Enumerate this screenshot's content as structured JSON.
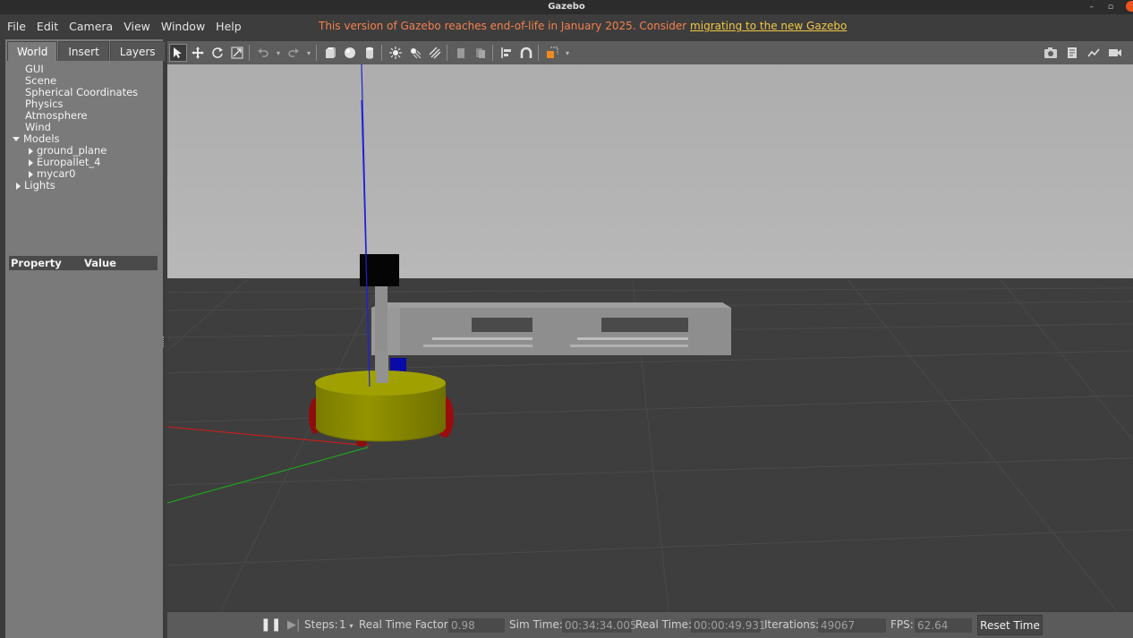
{
  "window": {
    "title": "Gazebo",
    "minimize": "–",
    "maximize": "▫"
  },
  "menu": {
    "items": [
      "File",
      "Edit",
      "Camera",
      "View",
      "Window",
      "Help"
    ],
    "eol_text": "This version of Gazebo reaches end-of-life in January 2025. Consider",
    "eol_link": "migrating to the new Gazebo"
  },
  "left_panel": {
    "tabs": [
      "World",
      "Insert",
      "Layers"
    ],
    "tree": {
      "gui": "GUI",
      "scene": "Scene",
      "spherical": "Spherical Coordinates",
      "physics": "Physics",
      "atmosphere": "Atmosphere",
      "wind": "Wind",
      "models": "Models",
      "model_items": [
        "ground_plane",
        "Europallet_4",
        "mycar0"
      ],
      "lights": "Lights"
    },
    "property_header": {
      "property": "Property",
      "value": "Value"
    }
  },
  "toolbar": {
    "icons": [
      "select-arrow-icon",
      "translate-icon",
      "rotate-icon",
      "scale-icon",
      "undo-icon",
      "redo-icon",
      "box-icon",
      "sphere-icon",
      "cylinder-icon",
      "point-light-icon",
      "spot-light-icon",
      "directional-light-icon",
      "copy-icon",
      "paste-icon",
      "align-icon",
      "magnet-icon",
      "view-angle-icon"
    ],
    "right_icons": [
      "screenshot-icon",
      "log-icon",
      "plot-icon",
      "video-icon"
    ]
  },
  "status": {
    "steps_label": "Steps:",
    "steps_value": "1",
    "rtf_label": "Real Time Factor:",
    "rtf_value": "0.98",
    "sim_time_label": "Sim Time:",
    "sim_time_value": "00:34:34.005",
    "real_time_label": "Real Time:",
    "real_time_value": "00:00:49.931",
    "iterations_label": "Iterations:",
    "iterations_value": "49067",
    "fps_label": "FPS:",
    "fps_value": "62.64",
    "reset_label": "Reset Time"
  },
  "colors": {
    "sky": "#b1b1b1",
    "ground": "#3e3e3e",
    "robot_body": "#8f8f00",
    "robot_wheels": "#8e0c0c",
    "pallet": "#8c8c8c",
    "eol_text": "#f4804d",
    "eol_link": "#f2c744"
  }
}
